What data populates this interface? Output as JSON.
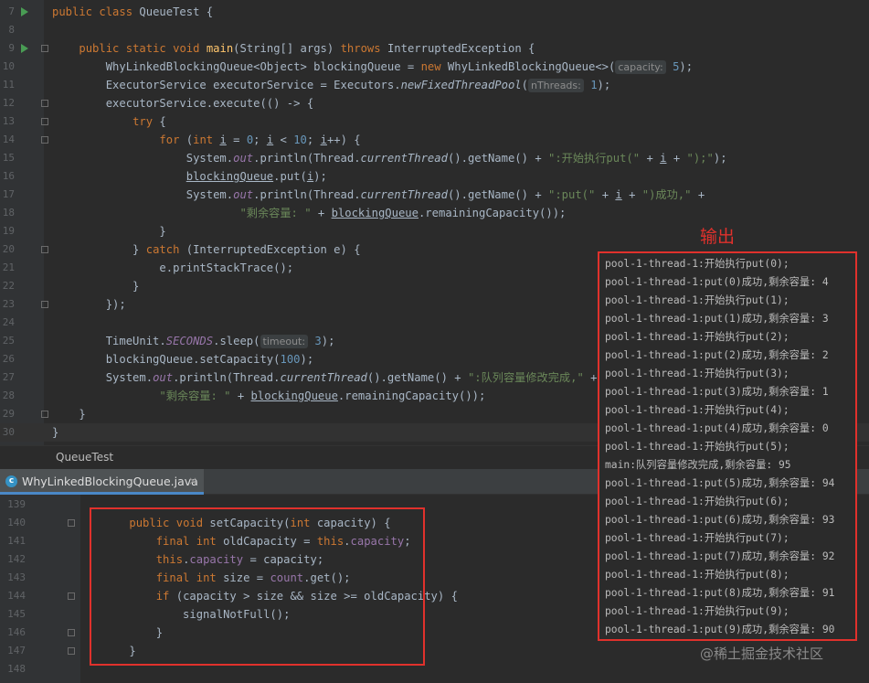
{
  "top_lines": [
    {
      "n": "7",
      "code": "public class QueueTest {"
    },
    {
      "n": "8",
      "code": ""
    },
    {
      "n": "9",
      "code": "    public static void main(String[] args) throws InterruptedException {"
    },
    {
      "n": "10",
      "code": "        WhyLinkedBlockingQueue<Object> blockingQueue = new WhyLinkedBlockingQueue<>( capacity: 5);"
    },
    {
      "n": "11",
      "code": "        ExecutorService executorService = Executors.newFixedThreadPool( nThreads: 1);"
    },
    {
      "n": "12",
      "code": "        executorService.execute(() -> {"
    },
    {
      "n": "13",
      "code": "            try {"
    },
    {
      "n": "14",
      "code": "                for (int i = 0; i < 10; i++) {"
    },
    {
      "n": "15",
      "code": "                    System.out.println(Thread.currentThread().getName() + \":开始执行put(\" + i + \");\");"
    },
    {
      "n": "16",
      "code": "                    blockingQueue.put(i);"
    },
    {
      "n": "17",
      "code": "                    System.out.println(Thread.currentThread().getName() + \":put(\" + i + \")成功,\" +"
    },
    {
      "n": "18",
      "code": "                            \"剩余容量: \" + blockingQueue.remainingCapacity());"
    },
    {
      "n": "19",
      "code": "                }"
    },
    {
      "n": "20",
      "code": "            } catch (InterruptedException e) {"
    },
    {
      "n": "21",
      "code": "                e.printStackTrace();"
    },
    {
      "n": "22",
      "code": "            }"
    },
    {
      "n": "23",
      "code": "        });"
    },
    {
      "n": "24",
      "code": ""
    },
    {
      "n": "25",
      "code": "        TimeUnit.SECONDS.sleep( timeout: 3);"
    },
    {
      "n": "26",
      "code": "        blockingQueue.setCapacity(100);"
    },
    {
      "n": "27",
      "code": "        System.out.println(Thread.currentThread().getName() + \":队列容量修改完成,\" +"
    },
    {
      "n": "28",
      "code": "                \"剩余容量: \" + blockingQueue.remainingCapacity());"
    },
    {
      "n": "29",
      "code": "    }"
    },
    {
      "n": "30",
      "code": "}"
    }
  ],
  "breadcrumb": "QueueTest",
  "tab": {
    "label": "WhyLinkedBlockingQueue.java",
    "icon": "class-icon",
    "icon_letter": "c",
    "close": "×"
  },
  "bottom_lines": [
    {
      "n": "139",
      "code": ""
    },
    {
      "n": "140",
      "code": "    public void setCapacity(int capacity) {"
    },
    {
      "n": "141",
      "code": "        final int oldCapacity = this.capacity;"
    },
    {
      "n": "142",
      "code": "        this.capacity = capacity;"
    },
    {
      "n": "143",
      "code": "        final int size = count.get();"
    },
    {
      "n": "144",
      "code": "        if (capacity > size && size >= oldCapacity) {"
    },
    {
      "n": "145",
      "code": "            signalNotFull();"
    },
    {
      "n": "146",
      "code": "        }"
    },
    {
      "n": "147",
      "code": "    }"
    },
    {
      "n": "148",
      "code": ""
    }
  ],
  "output_title": "输出",
  "output_lines": [
    "pool-1-thread-1:开始执行put(0);",
    "pool-1-thread-1:put(0)成功,剩余容量: 4",
    "pool-1-thread-1:开始执行put(1);",
    "pool-1-thread-1:put(1)成功,剩余容量: 3",
    "pool-1-thread-1:开始执行put(2);",
    "pool-1-thread-1:put(2)成功,剩余容量: 2",
    "pool-1-thread-1:开始执行put(3);",
    "pool-1-thread-1:put(3)成功,剩余容量: 1",
    "pool-1-thread-1:开始执行put(4);",
    "pool-1-thread-1:put(4)成功,剩余容量: 0",
    "pool-1-thread-1:开始执行put(5);",
    "main:队列容量修改完成,剩余容量: 95",
    "pool-1-thread-1:put(5)成功,剩余容量: 94",
    "pool-1-thread-1:开始执行put(6);",
    "pool-1-thread-1:put(6)成功,剩余容量: 93",
    "pool-1-thread-1:开始执行put(7);",
    "pool-1-thread-1:put(7)成功,剩余容量: 92",
    "pool-1-thread-1:开始执行put(8);",
    "pool-1-thread-1:put(8)成功,剩余容量: 91",
    "pool-1-thread-1:开始执行put(9);",
    "pool-1-thread-1:put(9)成功,剩余容量: 90"
  ],
  "watermark": "@稀土掘金技术社区",
  "colors": {
    "keyword": "#cc7832",
    "string": "#6a8759",
    "number": "#6897bb",
    "highlight_box": "#e0312c",
    "background": "#2b2b2b"
  }
}
